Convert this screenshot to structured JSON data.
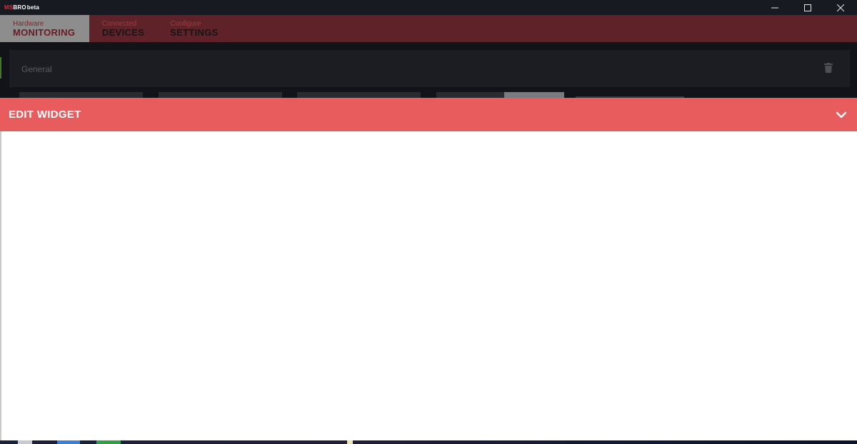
{
  "app": {
    "logo_prefix": "MS",
    "logo_main": "BRO",
    "logo_suffix": "beta",
    "icons": {
      "minimize": "minimize-icon",
      "maximize": "maximize-icon",
      "close": "close-icon"
    }
  },
  "nav": {
    "tabs": [
      {
        "small": "Hardware",
        "big": "MONITORING",
        "active": true
      },
      {
        "small": "Connected",
        "big": "DEVICES",
        "active": false
      },
      {
        "small": "Configure",
        "big": "SETTINGS",
        "active": false
      }
    ]
  },
  "panel": {
    "title": "General",
    "delete_icon": "trash-icon"
  },
  "edit_widget": {
    "title": "EDIT WIDGET",
    "collapse_icon": "chevron-down-icon"
  },
  "colors": {
    "nav_bg": "#5f2229",
    "nav_active": "#8d8d8d",
    "edit_header": "#e85c5e",
    "accent_red": "#e0283a"
  }
}
